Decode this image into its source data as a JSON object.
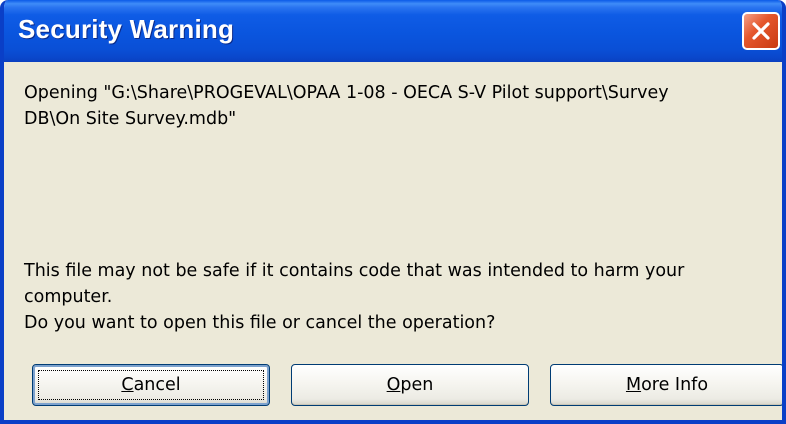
{
  "dialog": {
    "title": "Security Warning",
    "close_icon": "close-x-icon",
    "message_line1": "Opening \"G:\\Share\\PROGEVAL\\OPAA 1-08 - OECA S-V Pilot support\\Survey",
    "message_line2": "DB\\On Site Survey.mdb\"",
    "warning_line1": "This file may not be safe if it contains code that was intended to harm your",
    "warning_line2": "computer.",
    "warning_line3": "Do you want to open this file or cancel the operation?"
  },
  "buttons": {
    "cancel": {
      "accel": "C",
      "rest": "ancel"
    },
    "open": {
      "accel": "O",
      "rest": "pen"
    },
    "more_info": {
      "accel": "M",
      "rest": "ore Info"
    }
  },
  "colors": {
    "title_bar": "#0a55de",
    "dialog_face": "#ece9d8",
    "close_button": "#e5572c"
  }
}
